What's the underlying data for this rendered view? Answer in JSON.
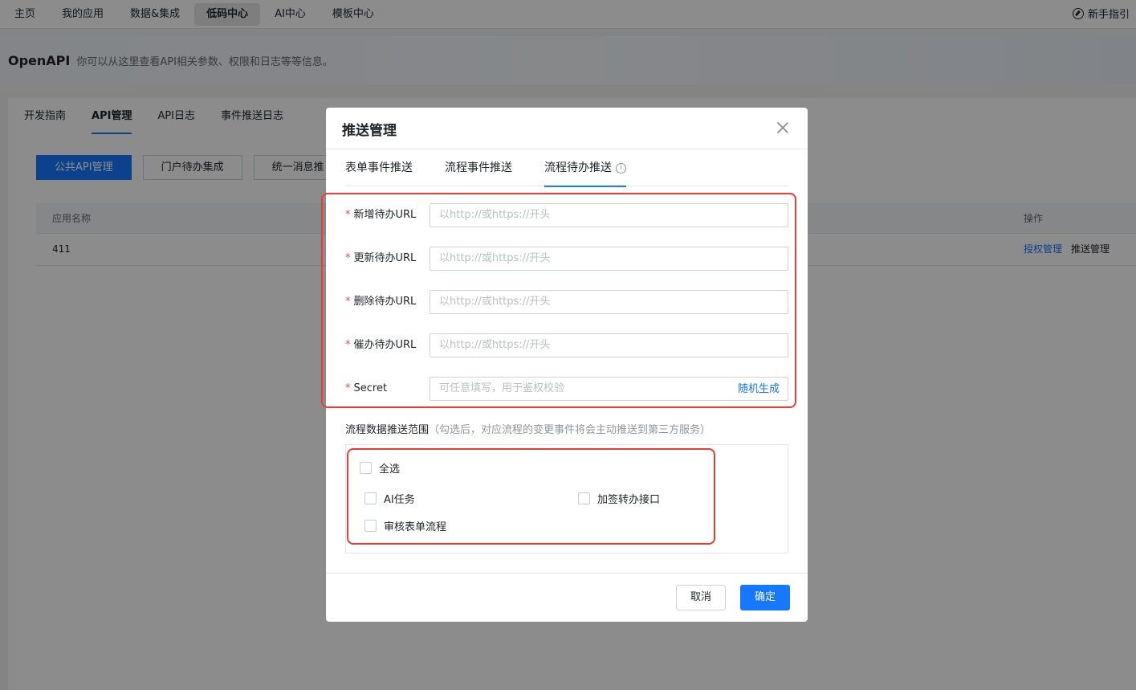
{
  "topnav": {
    "items": [
      "主页",
      "我的应用",
      "数据&集成",
      "低码中心",
      "AI中心",
      "模板中心"
    ],
    "guide_label": "新手指引"
  },
  "banner": {
    "title": "OpenAPI",
    "desc": "你可以从这里查看API相关参数、权限和日志等等信息。"
  },
  "subtabs": [
    "开发指南",
    "API管理",
    "API日志",
    "事件推送日志"
  ],
  "buttons": [
    "公共API管理",
    "门户待办集成",
    "统一消息推"
  ],
  "table": {
    "headers": {
      "name": "应用名称",
      "ops": "操作"
    },
    "rows": [
      {
        "name": "411",
        "op_auth": "授权管理",
        "op_push": "推送管理"
      }
    ]
  },
  "modal": {
    "title": "推送管理",
    "tabs": [
      "表单事件推送",
      "流程事件推送",
      "流程待办推送"
    ],
    "fields": [
      {
        "label": "新增待办URL",
        "placeholder": "以http://或https://开头"
      },
      {
        "label": "更新待办URL",
        "placeholder": "以http://或https://开头"
      },
      {
        "label": "删除待办URL",
        "placeholder": "以http://或https://开头"
      },
      {
        "label": "催办待办URL",
        "placeholder": "以http://或https://开头"
      }
    ],
    "secret": {
      "label": "Secret",
      "placeholder": "可任意填写，用于鉴权校验",
      "generate": "随机生成"
    },
    "required_mark": "*",
    "scope": {
      "title": "流程数据推送范围",
      "hint": "（勾选后，对应流程的变更事件将会主动推送到第三方服务）",
      "select_all": "全选",
      "options": [
        "AI任务",
        "加签转办接口",
        "审核表单流程"
      ]
    },
    "cancel": "取消",
    "ok": "确定"
  },
  "colors": {
    "primary": "#1677ff",
    "highlight_box": "#ee3a34",
    "required": "#f54a45"
  }
}
